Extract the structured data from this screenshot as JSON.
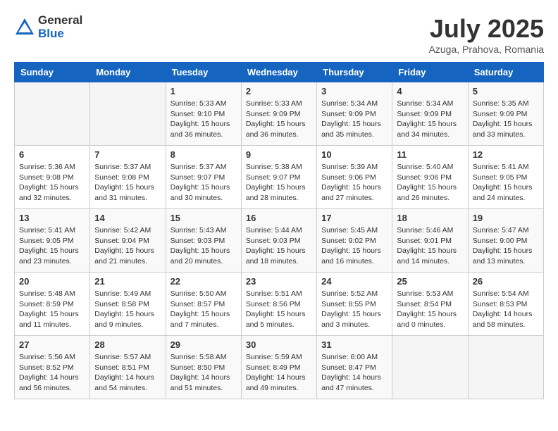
{
  "header": {
    "logo_general": "General",
    "logo_blue": "Blue",
    "month_year": "July 2025",
    "location": "Azuga, Prahova, Romania"
  },
  "days_of_week": [
    "Sunday",
    "Monday",
    "Tuesday",
    "Wednesday",
    "Thursday",
    "Friday",
    "Saturday"
  ],
  "weeks": [
    [
      {
        "day": "",
        "info": ""
      },
      {
        "day": "",
        "info": ""
      },
      {
        "day": "1",
        "info": "Sunrise: 5:33 AM\nSunset: 9:10 PM\nDaylight: 15 hours and 36 minutes."
      },
      {
        "day": "2",
        "info": "Sunrise: 5:33 AM\nSunset: 9:09 PM\nDaylight: 15 hours and 36 minutes."
      },
      {
        "day": "3",
        "info": "Sunrise: 5:34 AM\nSunset: 9:09 PM\nDaylight: 15 hours and 35 minutes."
      },
      {
        "day": "4",
        "info": "Sunrise: 5:34 AM\nSunset: 9:09 PM\nDaylight: 15 hours and 34 minutes."
      },
      {
        "day": "5",
        "info": "Sunrise: 5:35 AM\nSunset: 9:09 PM\nDaylight: 15 hours and 33 minutes."
      }
    ],
    [
      {
        "day": "6",
        "info": "Sunrise: 5:36 AM\nSunset: 9:08 PM\nDaylight: 15 hours and 32 minutes."
      },
      {
        "day": "7",
        "info": "Sunrise: 5:37 AM\nSunset: 9:08 PM\nDaylight: 15 hours and 31 minutes."
      },
      {
        "day": "8",
        "info": "Sunrise: 5:37 AM\nSunset: 9:07 PM\nDaylight: 15 hours and 30 minutes."
      },
      {
        "day": "9",
        "info": "Sunrise: 5:38 AM\nSunset: 9:07 PM\nDaylight: 15 hours and 28 minutes."
      },
      {
        "day": "10",
        "info": "Sunrise: 5:39 AM\nSunset: 9:06 PM\nDaylight: 15 hours and 27 minutes."
      },
      {
        "day": "11",
        "info": "Sunrise: 5:40 AM\nSunset: 9:06 PM\nDaylight: 15 hours and 26 minutes."
      },
      {
        "day": "12",
        "info": "Sunrise: 5:41 AM\nSunset: 9:05 PM\nDaylight: 15 hours and 24 minutes."
      }
    ],
    [
      {
        "day": "13",
        "info": "Sunrise: 5:41 AM\nSunset: 9:05 PM\nDaylight: 15 hours and 23 minutes."
      },
      {
        "day": "14",
        "info": "Sunrise: 5:42 AM\nSunset: 9:04 PM\nDaylight: 15 hours and 21 minutes."
      },
      {
        "day": "15",
        "info": "Sunrise: 5:43 AM\nSunset: 9:03 PM\nDaylight: 15 hours and 20 minutes."
      },
      {
        "day": "16",
        "info": "Sunrise: 5:44 AM\nSunset: 9:03 PM\nDaylight: 15 hours and 18 minutes."
      },
      {
        "day": "17",
        "info": "Sunrise: 5:45 AM\nSunset: 9:02 PM\nDaylight: 15 hours and 16 minutes."
      },
      {
        "day": "18",
        "info": "Sunrise: 5:46 AM\nSunset: 9:01 PM\nDaylight: 15 hours and 14 minutes."
      },
      {
        "day": "19",
        "info": "Sunrise: 5:47 AM\nSunset: 9:00 PM\nDaylight: 15 hours and 13 minutes."
      }
    ],
    [
      {
        "day": "20",
        "info": "Sunrise: 5:48 AM\nSunset: 8:59 PM\nDaylight: 15 hours and 11 minutes."
      },
      {
        "day": "21",
        "info": "Sunrise: 5:49 AM\nSunset: 8:58 PM\nDaylight: 15 hours and 9 minutes."
      },
      {
        "day": "22",
        "info": "Sunrise: 5:50 AM\nSunset: 8:57 PM\nDaylight: 15 hours and 7 minutes."
      },
      {
        "day": "23",
        "info": "Sunrise: 5:51 AM\nSunset: 8:56 PM\nDaylight: 15 hours and 5 minutes."
      },
      {
        "day": "24",
        "info": "Sunrise: 5:52 AM\nSunset: 8:55 PM\nDaylight: 15 hours and 3 minutes."
      },
      {
        "day": "25",
        "info": "Sunrise: 5:53 AM\nSunset: 8:54 PM\nDaylight: 15 hours and 0 minutes."
      },
      {
        "day": "26",
        "info": "Sunrise: 5:54 AM\nSunset: 8:53 PM\nDaylight: 14 hours and 58 minutes."
      }
    ],
    [
      {
        "day": "27",
        "info": "Sunrise: 5:56 AM\nSunset: 8:52 PM\nDaylight: 14 hours and 56 minutes."
      },
      {
        "day": "28",
        "info": "Sunrise: 5:57 AM\nSunset: 8:51 PM\nDaylight: 14 hours and 54 minutes."
      },
      {
        "day": "29",
        "info": "Sunrise: 5:58 AM\nSunset: 8:50 PM\nDaylight: 14 hours and 51 minutes."
      },
      {
        "day": "30",
        "info": "Sunrise: 5:59 AM\nSunset: 8:49 PM\nDaylight: 14 hours and 49 minutes."
      },
      {
        "day": "31",
        "info": "Sunrise: 6:00 AM\nSunset: 8:47 PM\nDaylight: 14 hours and 47 minutes."
      },
      {
        "day": "",
        "info": ""
      },
      {
        "day": "",
        "info": ""
      }
    ]
  ]
}
